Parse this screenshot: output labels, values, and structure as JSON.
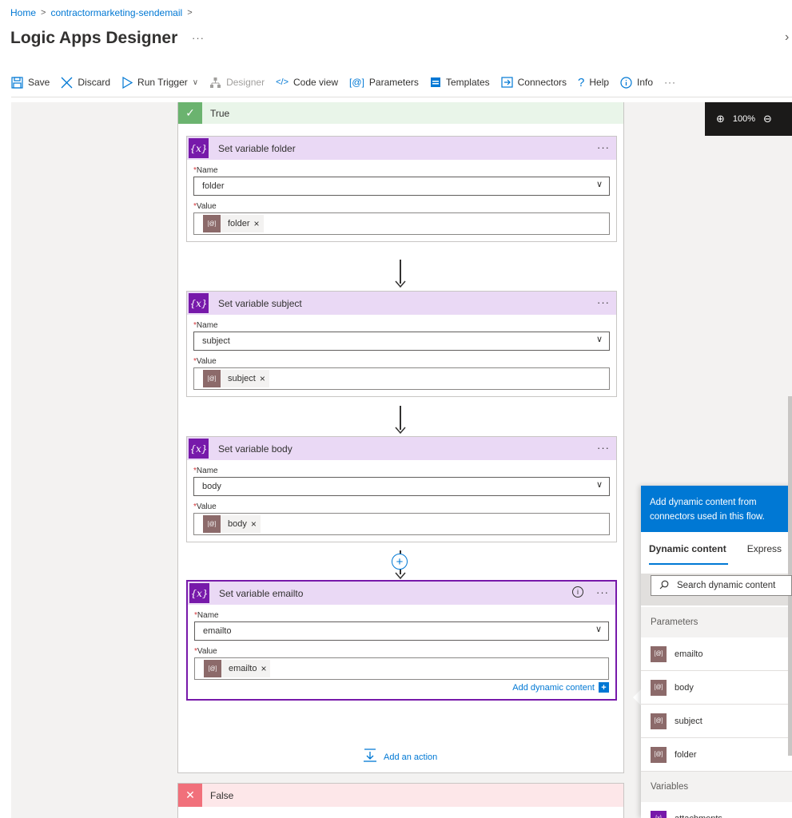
{
  "breadcrumb": {
    "home": "Home",
    "app": "contractormarketing-sendemail"
  },
  "page": {
    "title": "Logic Apps Designer"
  },
  "toolbar": {
    "save": "Save",
    "discard": "Discard",
    "run_trigger": "Run Trigger",
    "designer": "Designer",
    "code_view": "Code view",
    "parameters": "Parameters",
    "templates": "Templates",
    "connectors": "Connectors",
    "help": "Help",
    "info": "Info"
  },
  "zoom": {
    "level": "100%"
  },
  "scope_true": {
    "label": "True"
  },
  "scope_false": {
    "label": "False"
  },
  "cards": [
    {
      "title": "Set variable folder",
      "name_label": "Name",
      "name_value": "folder",
      "value_label": "Value",
      "token": "folder"
    },
    {
      "title": "Set variable subject",
      "name_label": "Name",
      "name_value": "subject",
      "value_label": "Value",
      "token": "subject"
    },
    {
      "title": "Set variable body",
      "name_label": "Name",
      "name_value": "body",
      "value_label": "Value",
      "token": "body"
    },
    {
      "title": "Set variable emailto",
      "name_label": "Name",
      "name_value": "emailto",
      "value_label": "Value",
      "token": "emailto"
    }
  ],
  "add_dynamic_content": "Add dynamic content",
  "add_action": "Add an action",
  "dynamic_panel": {
    "header": "Add dynamic content from connectors used in this flow.",
    "tab_dynamic": "Dynamic content",
    "tab_expression": "Express",
    "search_placeholder": "Search dynamic content",
    "section_parameters": "Parameters",
    "parameters": [
      "emailto",
      "body",
      "subject",
      "folder"
    ],
    "section_variables": "Variables",
    "variables": [
      "attachments"
    ]
  }
}
